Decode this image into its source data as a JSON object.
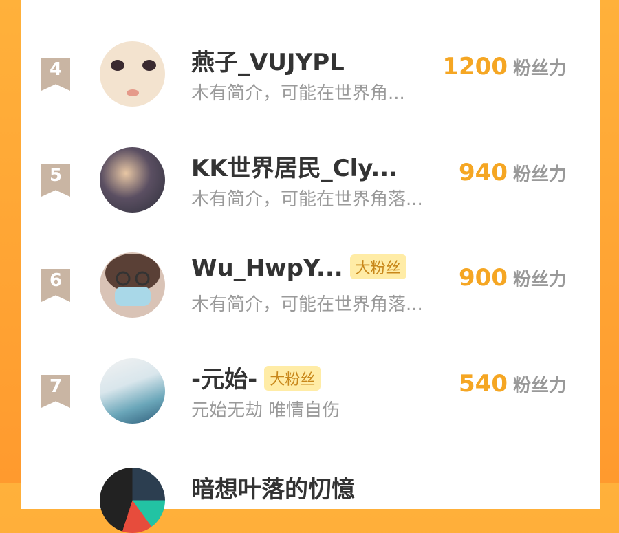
{
  "rows": [
    {
      "rank": "4",
      "name": "燕子_VUJYPL",
      "badge": "",
      "desc": "木有简介，可能在世界角...",
      "score": "1200",
      "unit": "粉丝力"
    },
    {
      "rank": "5",
      "name": "KK世界居民_Cly...",
      "badge": "",
      "desc": "木有简介，可能在世界角落...",
      "score": "940",
      "unit": "粉丝力"
    },
    {
      "rank": "6",
      "name": "Wu_HwpY...",
      "badge": "大粉丝",
      "desc": "木有简介，可能在世界角落...",
      "score": "900",
      "unit": "粉丝力"
    },
    {
      "rank": "7",
      "name": "-元始-",
      "badge": "大粉丝",
      "desc": "元始无劫 唯情自伤",
      "score": "540",
      "unit": "粉丝力"
    }
  ],
  "partial_row": {
    "name": "暗想叶落的忉憶"
  },
  "colors": {
    "accent": "#f5a623",
    "badge_bg": "#ffeca6",
    "rank_bg": "#c9b5a3",
    "frame": "#ff9a2e"
  }
}
